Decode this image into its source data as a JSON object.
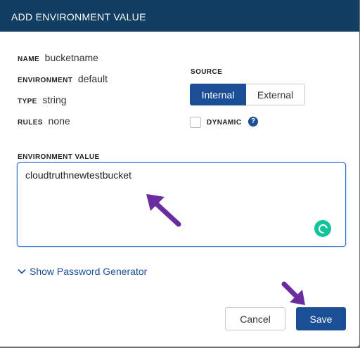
{
  "dialog": {
    "title": "ADD ENVIRONMENT VALUE"
  },
  "meta": {
    "name_label": "NAME",
    "name_value": "bucketname",
    "environment_label": "ENVIRONMENT",
    "environment_value": "default",
    "type_label": "TYPE",
    "type_value": "string",
    "rules_label": "RULES",
    "rules_value": "none"
  },
  "source": {
    "label": "SOURCE",
    "options": [
      "Internal",
      "External"
    ],
    "selected": "Internal"
  },
  "dynamic": {
    "label": "DYNAMIC",
    "checked": false,
    "help_icon": "?"
  },
  "environment_value": {
    "label": "ENVIRONMENT VALUE",
    "value": "cloudtruthnewtestbucket"
  },
  "password_generator": {
    "label": "Show Password Generator"
  },
  "buttons": {
    "cancel": "Cancel",
    "save": "Save"
  },
  "colors": {
    "header": "#123e63",
    "primary": "#1a4f96",
    "annotation_arrow": "#6a2c9e",
    "grammarly": "#15c39a"
  }
}
